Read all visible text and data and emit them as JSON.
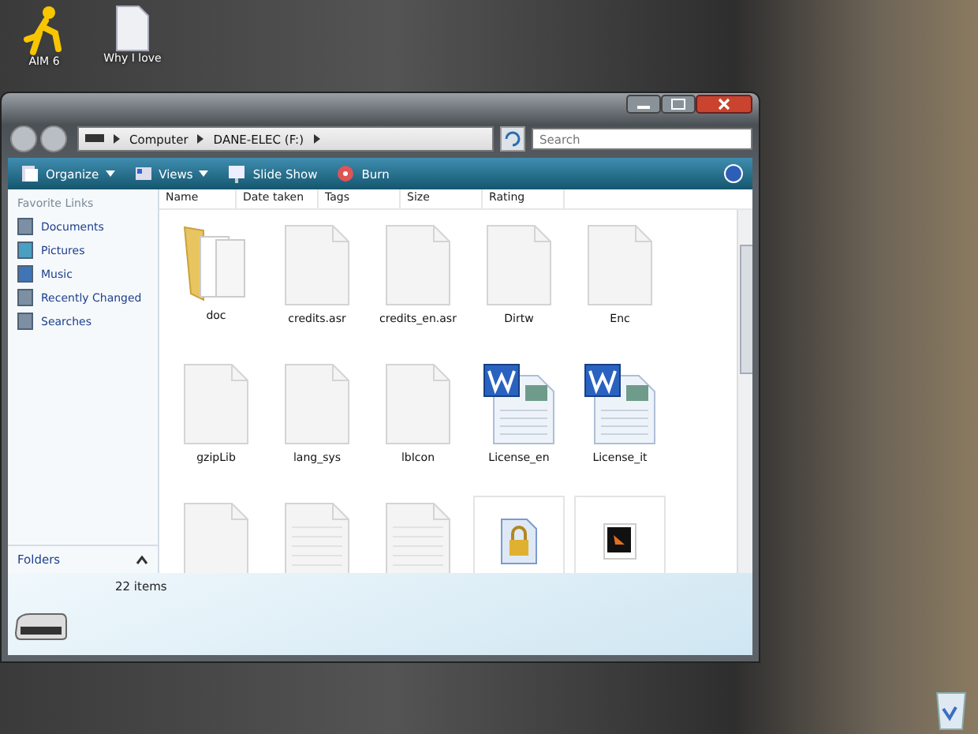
{
  "desktop_icons": [
    {
      "kind": "runner",
      "label": "AIM 6"
    },
    {
      "kind": "doc",
      "label": "Why I love"
    }
  ],
  "window": {
    "address": [
      "Computer",
      "DANE-ELEC (F:)"
    ],
    "search": {
      "placeholder": "Search"
    }
  },
  "toolbar": [
    {
      "kind": "organize",
      "label": "Organize",
      "dropdown": true
    },
    {
      "kind": "views",
      "label": "Views",
      "dropdown": true
    },
    {
      "kind": "slideshow",
      "label": "Slide Show",
      "dropdown": false
    },
    {
      "kind": "burn",
      "label": "Burn",
      "dropdown": false
    }
  ],
  "sidebar": {
    "heading": "Favorite Links",
    "items": [
      {
        "kind": "docs",
        "label": "Documents"
      },
      {
        "kind": "pics",
        "label": "Pictures"
      },
      {
        "kind": "music",
        "label": "Music"
      },
      {
        "kind": "recent",
        "label": "Recently Changed"
      },
      {
        "kind": "search",
        "label": "Searches"
      }
    ],
    "folders": "Folders"
  },
  "columns": [
    "Name",
    "Date taken",
    "Tags",
    "Size",
    "Rating"
  ],
  "files": [
    {
      "kind": "folder",
      "name": "doc"
    },
    {
      "kind": "blank",
      "name": "credits.asr"
    },
    {
      "kind": "blank",
      "name": "credits_en.asr"
    },
    {
      "kind": "blank",
      "name": "Dirtw"
    },
    {
      "kind": "blank",
      "name": "Enc"
    },
    {
      "kind": "blank",
      "name": "gzipLib"
    },
    {
      "kind": "blank",
      "name": "lang_sys"
    },
    {
      "kind": "blank",
      "name": "lbIcon"
    },
    {
      "kind": "word",
      "name": "License_en"
    },
    {
      "kind": "word",
      "name": "License_it"
    },
    {
      "kind": "blank"
    },
    {
      "kind": "lined"
    },
    {
      "kind": "lined"
    },
    {
      "kind": "lock"
    },
    {
      "kind": "media"
    }
  ],
  "details": {
    "count": "22 items"
  }
}
